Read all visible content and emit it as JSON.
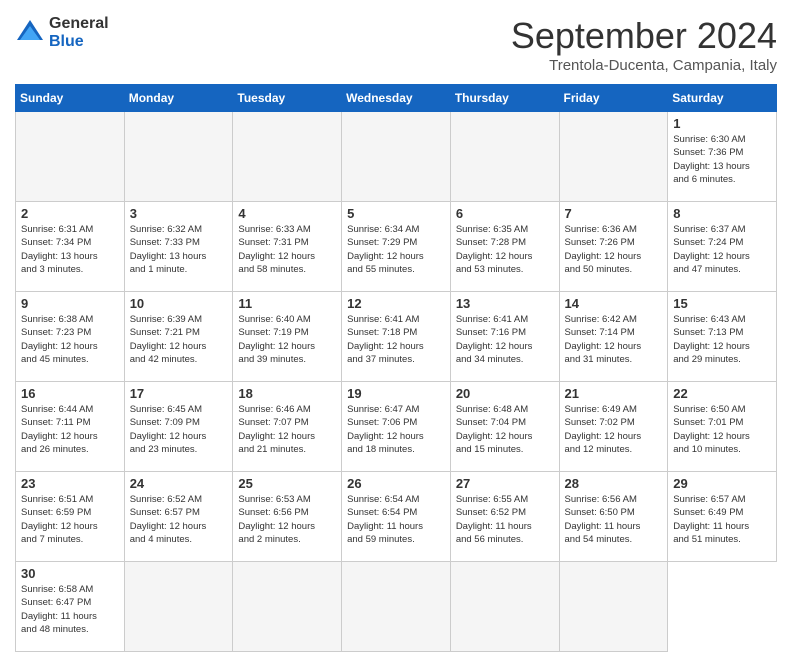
{
  "logo": {
    "general": "General",
    "blue": "Blue"
  },
  "title": "September 2024",
  "location": "Trentola-Ducenta, Campania, Italy",
  "weekdays": [
    "Sunday",
    "Monday",
    "Tuesday",
    "Wednesday",
    "Thursday",
    "Friday",
    "Saturday"
  ],
  "days": [
    {
      "day": "",
      "info": ""
    },
    {
      "day": "",
      "info": ""
    },
    {
      "day": "",
      "info": ""
    },
    {
      "day": "",
      "info": ""
    },
    {
      "day": "",
      "info": ""
    },
    {
      "day": "",
      "info": ""
    },
    {
      "day": "1",
      "info": "Sunrise: 6:30 AM\nSunset: 7:36 PM\nDaylight: 13 hours\nand 6 minutes."
    },
    {
      "day": "2",
      "info": "Sunrise: 6:31 AM\nSunset: 7:34 PM\nDaylight: 13 hours\nand 3 minutes."
    },
    {
      "day": "3",
      "info": "Sunrise: 6:32 AM\nSunset: 7:33 PM\nDaylight: 13 hours\nand 1 minute."
    },
    {
      "day": "4",
      "info": "Sunrise: 6:33 AM\nSunset: 7:31 PM\nDaylight: 12 hours\nand 58 minutes."
    },
    {
      "day": "5",
      "info": "Sunrise: 6:34 AM\nSunset: 7:29 PM\nDaylight: 12 hours\nand 55 minutes."
    },
    {
      "day": "6",
      "info": "Sunrise: 6:35 AM\nSunset: 7:28 PM\nDaylight: 12 hours\nand 53 minutes."
    },
    {
      "day": "7",
      "info": "Sunrise: 6:36 AM\nSunset: 7:26 PM\nDaylight: 12 hours\nand 50 minutes."
    },
    {
      "day": "8",
      "info": "Sunrise: 6:37 AM\nSunset: 7:24 PM\nDaylight: 12 hours\nand 47 minutes."
    },
    {
      "day": "9",
      "info": "Sunrise: 6:38 AM\nSunset: 7:23 PM\nDaylight: 12 hours\nand 45 minutes."
    },
    {
      "day": "10",
      "info": "Sunrise: 6:39 AM\nSunset: 7:21 PM\nDaylight: 12 hours\nand 42 minutes."
    },
    {
      "day": "11",
      "info": "Sunrise: 6:40 AM\nSunset: 7:19 PM\nDaylight: 12 hours\nand 39 minutes."
    },
    {
      "day": "12",
      "info": "Sunrise: 6:41 AM\nSunset: 7:18 PM\nDaylight: 12 hours\nand 37 minutes."
    },
    {
      "day": "13",
      "info": "Sunrise: 6:41 AM\nSunset: 7:16 PM\nDaylight: 12 hours\nand 34 minutes."
    },
    {
      "day": "14",
      "info": "Sunrise: 6:42 AM\nSunset: 7:14 PM\nDaylight: 12 hours\nand 31 minutes."
    },
    {
      "day": "15",
      "info": "Sunrise: 6:43 AM\nSunset: 7:13 PM\nDaylight: 12 hours\nand 29 minutes."
    },
    {
      "day": "16",
      "info": "Sunrise: 6:44 AM\nSunset: 7:11 PM\nDaylight: 12 hours\nand 26 minutes."
    },
    {
      "day": "17",
      "info": "Sunrise: 6:45 AM\nSunset: 7:09 PM\nDaylight: 12 hours\nand 23 minutes."
    },
    {
      "day": "18",
      "info": "Sunrise: 6:46 AM\nSunset: 7:07 PM\nDaylight: 12 hours\nand 21 minutes."
    },
    {
      "day": "19",
      "info": "Sunrise: 6:47 AM\nSunset: 7:06 PM\nDaylight: 12 hours\nand 18 minutes."
    },
    {
      "day": "20",
      "info": "Sunrise: 6:48 AM\nSunset: 7:04 PM\nDaylight: 12 hours\nand 15 minutes."
    },
    {
      "day": "21",
      "info": "Sunrise: 6:49 AM\nSunset: 7:02 PM\nDaylight: 12 hours\nand 12 minutes."
    },
    {
      "day": "22",
      "info": "Sunrise: 6:50 AM\nSunset: 7:01 PM\nDaylight: 12 hours\nand 10 minutes."
    },
    {
      "day": "23",
      "info": "Sunrise: 6:51 AM\nSunset: 6:59 PM\nDaylight: 12 hours\nand 7 minutes."
    },
    {
      "day": "24",
      "info": "Sunrise: 6:52 AM\nSunset: 6:57 PM\nDaylight: 12 hours\nand 4 minutes."
    },
    {
      "day": "25",
      "info": "Sunrise: 6:53 AM\nSunset: 6:56 PM\nDaylight: 12 hours\nand 2 minutes."
    },
    {
      "day": "26",
      "info": "Sunrise: 6:54 AM\nSunset: 6:54 PM\nDaylight: 11 hours\nand 59 minutes."
    },
    {
      "day": "27",
      "info": "Sunrise: 6:55 AM\nSunset: 6:52 PM\nDaylight: 11 hours\nand 56 minutes."
    },
    {
      "day": "28",
      "info": "Sunrise: 6:56 AM\nSunset: 6:50 PM\nDaylight: 11 hours\nand 54 minutes."
    },
    {
      "day": "29",
      "info": "Sunrise: 6:57 AM\nSunset: 6:49 PM\nDaylight: 11 hours\nand 51 minutes."
    },
    {
      "day": "30",
      "info": "Sunrise: 6:58 AM\nSunset: 6:47 PM\nDaylight: 11 hours\nand 48 minutes."
    },
    {
      "day": "",
      "info": ""
    },
    {
      "day": "",
      "info": ""
    },
    {
      "day": "",
      "info": ""
    },
    {
      "day": "",
      "info": ""
    },
    {
      "day": "",
      "info": ""
    }
  ]
}
